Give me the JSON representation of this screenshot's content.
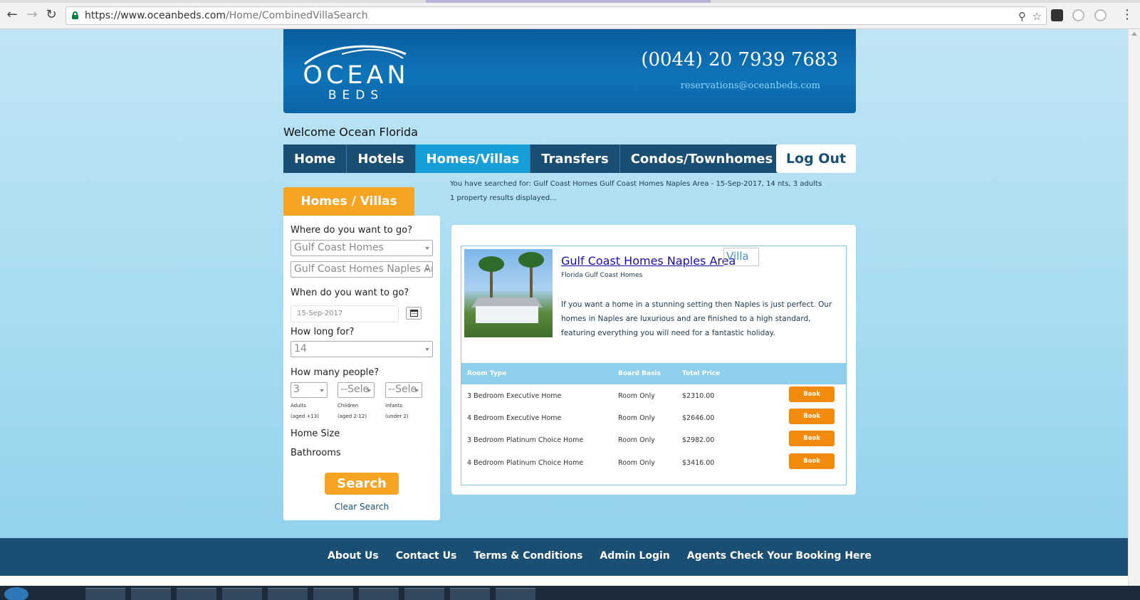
{
  "browser": {
    "url_host": "https://www.oceanbeds.com",
    "url_path": "/Home/CombinedVillaSearch"
  },
  "header": {
    "logo_word": "OCEAN",
    "logo_sub": "BEDS",
    "phone": "(0044) 20 7939 7683",
    "email": "reservations@oceanbeds.com"
  },
  "welcome": "Welcome Ocean Florida",
  "nav": {
    "items": [
      {
        "label": "Home"
      },
      {
        "label": "Hotels"
      },
      {
        "label": "Homes/Villas"
      },
      {
        "label": "Transfers"
      },
      {
        "label": "Condos/Townhomes"
      }
    ],
    "active": "Homes/Villas",
    "logout": "Log Out"
  },
  "summary": {
    "searched": "You have searched for: Gulf Coast Homes Gulf Coast Homes Naples Area - 15-Sep-2017, 14 nts, 3 adults",
    "count": "1 property results displayed..."
  },
  "sidebar": {
    "tab": "Homes / Villas",
    "where_label": "Where do you want to go?",
    "region": "Gulf Coast Homes",
    "area": "Gulf Coast Homes Naples Ar",
    "when_label": "When do you want to go?",
    "date": "15-Sep-2017",
    "howlong_label": "How long for?",
    "nights": "14",
    "people_label": "How many people?",
    "adults": "3",
    "children": "--Sele",
    "infants": "--Sele",
    "adults_label": "Adults",
    "adults_age": "(aged +13)",
    "children_label": "Children",
    "children_age": "(aged 2-12)",
    "infants_label": "Infants",
    "infants_age": "(under 2)",
    "home_size": "Home Size",
    "bathrooms": "Bathrooms",
    "search": "Search",
    "clear": "Clear Search"
  },
  "property": {
    "title": "Gulf Coast Homes Naples Area",
    "broken_img_alt": "Villa",
    "subtitle": "Florida Gulf Coast Homes",
    "description": "If you want a home in a stunning setting then Naples is just perfect. Our homes in Naples are luxurious and are finished to a high standard, featuring everything you will need for a fantastic holiday.",
    "columns": [
      "Room Type",
      "Board Basis",
      "Total Price"
    ],
    "rooms": [
      {
        "type": "3 Bedroom Executive Home",
        "board": "Room Only",
        "price": "$2310.00",
        "action": "Book"
      },
      {
        "type": "4 Bedroom Executive Home",
        "board": "Room Only",
        "price": "$2646.00",
        "action": "Book"
      },
      {
        "type": "3 Bedroom Platinum Choice Home",
        "board": "Room Only",
        "price": "$2982.00",
        "action": "Book"
      },
      {
        "type": "4 Bedroom Platinum Choice Home",
        "board": "Room Only",
        "price": "$3416.00",
        "action": "Book"
      }
    ]
  },
  "footer": {
    "links": [
      "About Us",
      "Contact Us",
      "Terms & Conditions",
      "Admin Login",
      "Agents Check Your Booking Here"
    ]
  },
  "colors": {
    "brand_blue": "#1a4e73",
    "active_tab": "#169fd8",
    "orange": "#f7a324",
    "book_orange": "#f18a0d"
  }
}
